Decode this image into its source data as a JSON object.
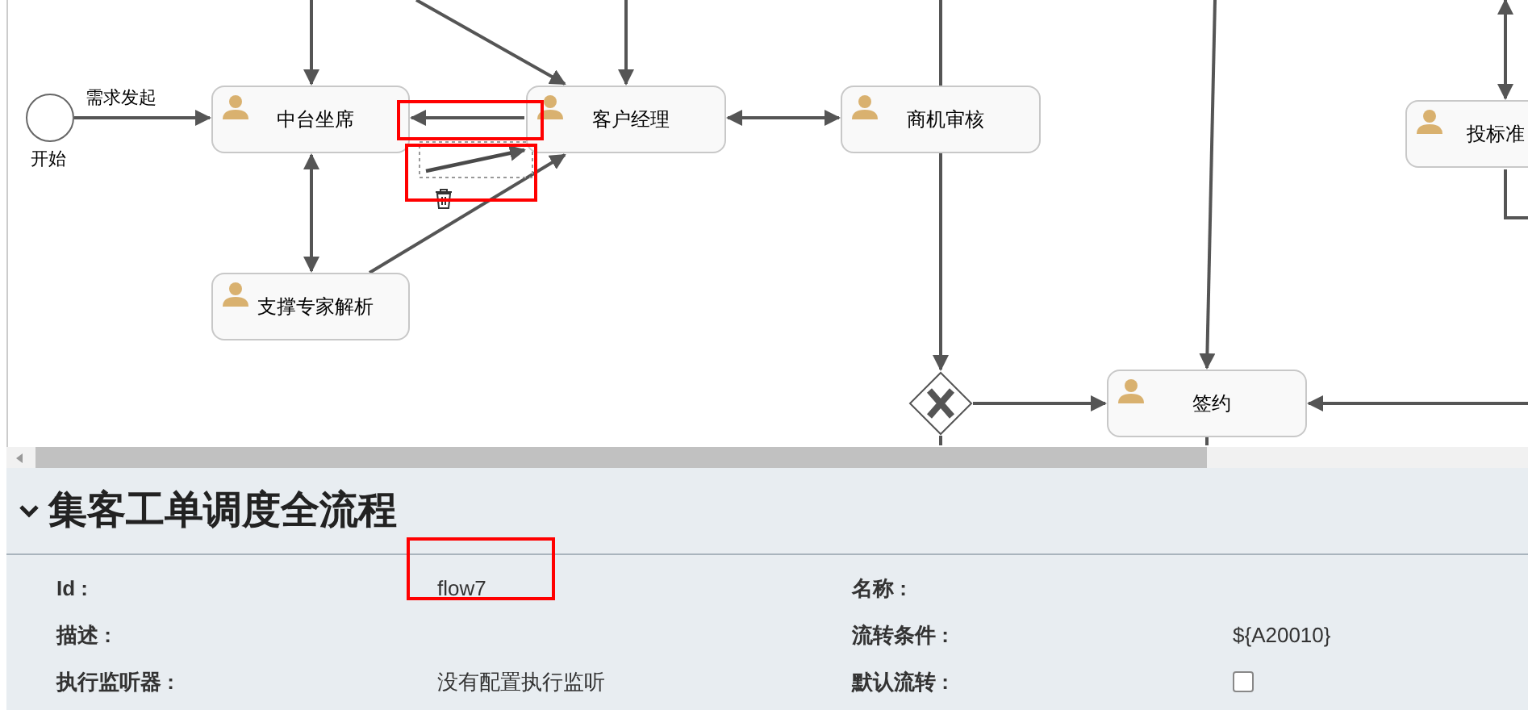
{
  "diagram": {
    "nodes": [
      {
        "kind": "start",
        "label": "开始"
      },
      {
        "kind": "task",
        "label": "中台坐席"
      },
      {
        "kind": "task",
        "label": "客户经理"
      },
      {
        "kind": "task",
        "label": "商机审核"
      },
      {
        "kind": "task",
        "label": "支撑专家解析"
      },
      {
        "kind": "gateway"
      },
      {
        "kind": "task",
        "label": "签约"
      },
      {
        "kind": "task",
        "label": "投标准"
      }
    ],
    "flows": [
      {
        "label": "需求发起",
        "selected": false
      },
      {
        "selected": true
      }
    ]
  },
  "panel": {
    "title": "集客工单调度全流程",
    "expanded": true,
    "fields": [
      {
        "kind": "text",
        "label": "Id :",
        "value": "flow7"
      },
      {
        "kind": "text",
        "label": "名称 :"
      },
      {
        "kind": "text",
        "label": "描述 :"
      },
      {
        "kind": "text",
        "label": "流转条件 :",
        "value": "${A20010}"
      },
      {
        "kind": "text",
        "label": "执行监听器 :",
        "value": "没有配置执行监听"
      },
      {
        "kind": "checkbox",
        "label": "默认流转 :",
        "checked": false
      }
    ]
  }
}
